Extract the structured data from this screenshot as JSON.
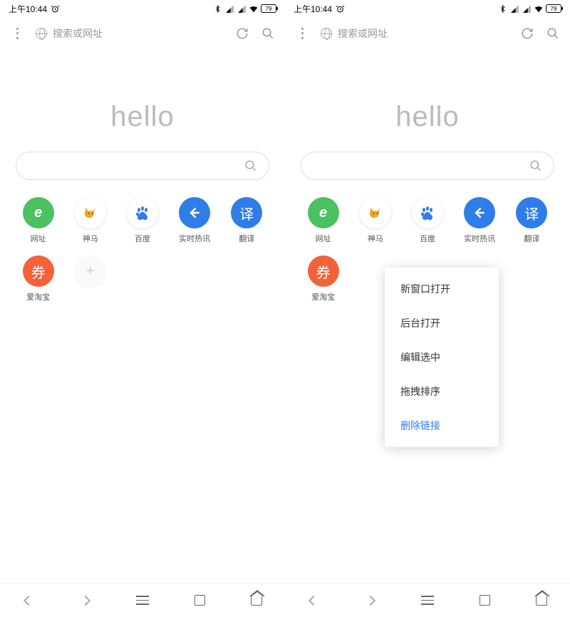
{
  "status": {
    "time": "上午10:44",
    "battery": "79"
  },
  "toolbar": {
    "search_placeholder": "搜索或网址"
  },
  "logo": "hello",
  "shortcuts": [
    {
      "label": "网址",
      "icon": "e-letter",
      "color": "green"
    },
    {
      "label": "神马",
      "icon": "fox",
      "color": "white"
    },
    {
      "label": "百度",
      "icon": "paw",
      "color": "white"
    },
    {
      "label": "实时热讯",
      "icon": "arrow",
      "color": "blue"
    },
    {
      "label": "翻译",
      "icon": "translate",
      "color": "blue"
    },
    {
      "label": "爱淘宝",
      "icon": "coupon",
      "color": "orange"
    }
  ],
  "add_label": "",
  "context_menu": {
    "items": [
      {
        "label": "新窗口打开"
      },
      {
        "label": "后台打开"
      },
      {
        "label": "编辑选中"
      },
      {
        "label": "拖拽排序"
      },
      {
        "label": "删除链接",
        "danger": true
      }
    ]
  },
  "icons": {
    "translate_glyph": "译",
    "coupon_glyph": "券",
    "e_glyph": "e",
    "plus_glyph": "+"
  }
}
